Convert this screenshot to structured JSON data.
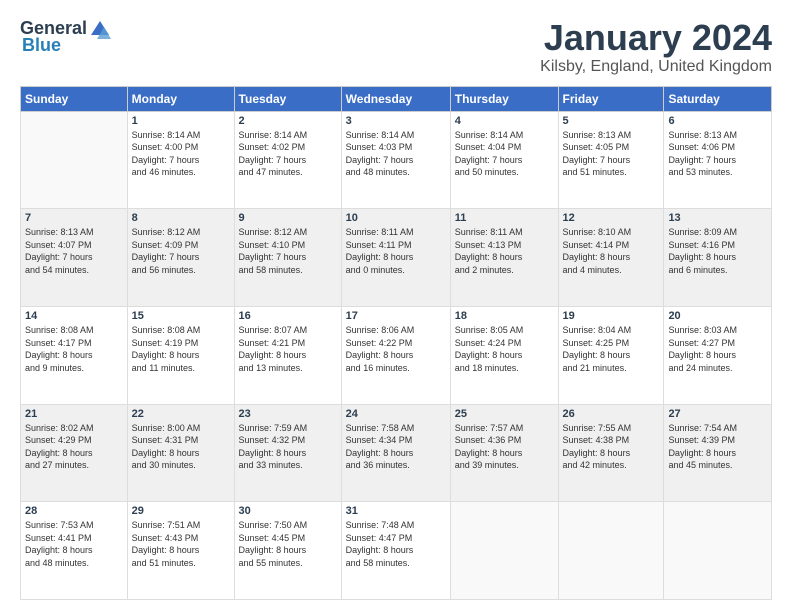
{
  "logo": {
    "general": "General",
    "blue": "Blue"
  },
  "title": "January 2024",
  "subtitle": "Kilsby, England, United Kingdom",
  "header_days": [
    "Sunday",
    "Monday",
    "Tuesday",
    "Wednesday",
    "Thursday",
    "Friday",
    "Saturday"
  ],
  "weeks": [
    [
      {
        "day": "",
        "info": ""
      },
      {
        "day": "1",
        "info": "Sunrise: 8:14 AM\nSunset: 4:00 PM\nDaylight: 7 hours\nand 46 minutes."
      },
      {
        "day": "2",
        "info": "Sunrise: 8:14 AM\nSunset: 4:02 PM\nDaylight: 7 hours\nand 47 minutes."
      },
      {
        "day": "3",
        "info": "Sunrise: 8:14 AM\nSunset: 4:03 PM\nDaylight: 7 hours\nand 48 minutes."
      },
      {
        "day": "4",
        "info": "Sunrise: 8:14 AM\nSunset: 4:04 PM\nDaylight: 7 hours\nand 50 minutes."
      },
      {
        "day": "5",
        "info": "Sunrise: 8:13 AM\nSunset: 4:05 PM\nDaylight: 7 hours\nand 51 minutes."
      },
      {
        "day": "6",
        "info": "Sunrise: 8:13 AM\nSunset: 4:06 PM\nDaylight: 7 hours\nand 53 minutes."
      }
    ],
    [
      {
        "day": "7",
        "info": "Sunrise: 8:13 AM\nSunset: 4:07 PM\nDaylight: 7 hours\nand 54 minutes."
      },
      {
        "day": "8",
        "info": "Sunrise: 8:12 AM\nSunset: 4:09 PM\nDaylight: 7 hours\nand 56 minutes."
      },
      {
        "day": "9",
        "info": "Sunrise: 8:12 AM\nSunset: 4:10 PM\nDaylight: 7 hours\nand 58 minutes."
      },
      {
        "day": "10",
        "info": "Sunrise: 8:11 AM\nSunset: 4:11 PM\nDaylight: 8 hours\nand 0 minutes."
      },
      {
        "day": "11",
        "info": "Sunrise: 8:11 AM\nSunset: 4:13 PM\nDaylight: 8 hours\nand 2 minutes."
      },
      {
        "day": "12",
        "info": "Sunrise: 8:10 AM\nSunset: 4:14 PM\nDaylight: 8 hours\nand 4 minutes."
      },
      {
        "day": "13",
        "info": "Sunrise: 8:09 AM\nSunset: 4:16 PM\nDaylight: 8 hours\nand 6 minutes."
      }
    ],
    [
      {
        "day": "14",
        "info": "Sunrise: 8:08 AM\nSunset: 4:17 PM\nDaylight: 8 hours\nand 9 minutes."
      },
      {
        "day": "15",
        "info": "Sunrise: 8:08 AM\nSunset: 4:19 PM\nDaylight: 8 hours\nand 11 minutes."
      },
      {
        "day": "16",
        "info": "Sunrise: 8:07 AM\nSunset: 4:21 PM\nDaylight: 8 hours\nand 13 minutes."
      },
      {
        "day": "17",
        "info": "Sunrise: 8:06 AM\nSunset: 4:22 PM\nDaylight: 8 hours\nand 16 minutes."
      },
      {
        "day": "18",
        "info": "Sunrise: 8:05 AM\nSunset: 4:24 PM\nDaylight: 8 hours\nand 18 minutes."
      },
      {
        "day": "19",
        "info": "Sunrise: 8:04 AM\nSunset: 4:25 PM\nDaylight: 8 hours\nand 21 minutes."
      },
      {
        "day": "20",
        "info": "Sunrise: 8:03 AM\nSunset: 4:27 PM\nDaylight: 8 hours\nand 24 minutes."
      }
    ],
    [
      {
        "day": "21",
        "info": "Sunrise: 8:02 AM\nSunset: 4:29 PM\nDaylight: 8 hours\nand 27 minutes."
      },
      {
        "day": "22",
        "info": "Sunrise: 8:00 AM\nSunset: 4:31 PM\nDaylight: 8 hours\nand 30 minutes."
      },
      {
        "day": "23",
        "info": "Sunrise: 7:59 AM\nSunset: 4:32 PM\nDaylight: 8 hours\nand 33 minutes."
      },
      {
        "day": "24",
        "info": "Sunrise: 7:58 AM\nSunset: 4:34 PM\nDaylight: 8 hours\nand 36 minutes."
      },
      {
        "day": "25",
        "info": "Sunrise: 7:57 AM\nSunset: 4:36 PM\nDaylight: 8 hours\nand 39 minutes."
      },
      {
        "day": "26",
        "info": "Sunrise: 7:55 AM\nSunset: 4:38 PM\nDaylight: 8 hours\nand 42 minutes."
      },
      {
        "day": "27",
        "info": "Sunrise: 7:54 AM\nSunset: 4:39 PM\nDaylight: 8 hours\nand 45 minutes."
      }
    ],
    [
      {
        "day": "28",
        "info": "Sunrise: 7:53 AM\nSunset: 4:41 PM\nDaylight: 8 hours\nand 48 minutes."
      },
      {
        "day": "29",
        "info": "Sunrise: 7:51 AM\nSunset: 4:43 PM\nDaylight: 8 hours\nand 51 minutes."
      },
      {
        "day": "30",
        "info": "Sunrise: 7:50 AM\nSunset: 4:45 PM\nDaylight: 8 hours\nand 55 minutes."
      },
      {
        "day": "31",
        "info": "Sunrise: 7:48 AM\nSunset: 4:47 PM\nDaylight: 8 hours\nand 58 minutes."
      },
      {
        "day": "",
        "info": ""
      },
      {
        "day": "",
        "info": ""
      },
      {
        "day": "",
        "info": ""
      }
    ]
  ]
}
